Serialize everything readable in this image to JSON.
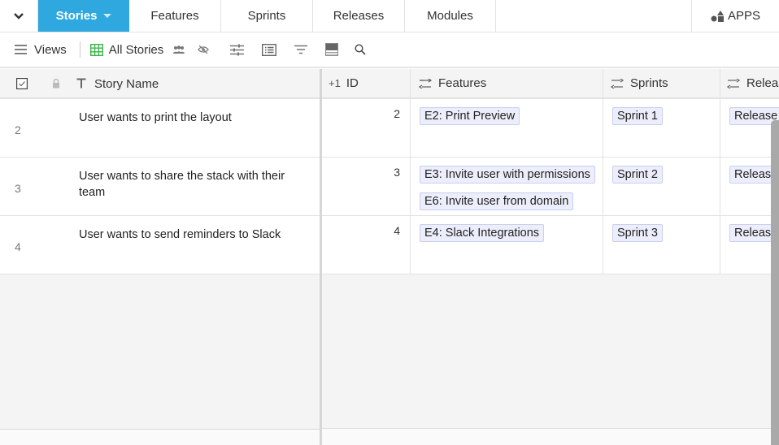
{
  "tabs": {
    "items": [
      {
        "label": "Stories",
        "active": true
      },
      {
        "label": "Features",
        "active": false
      },
      {
        "label": "Sprints",
        "active": false
      },
      {
        "label": "Releases",
        "active": false
      },
      {
        "label": "Modules",
        "active": false
      }
    ],
    "apps_label": "APPS"
  },
  "toolbar": {
    "views_label": "Views",
    "current_view_label": "All Stories",
    "icons": [
      "menu-icon",
      "grid-icon",
      "users-icon",
      "eye-off-icon",
      "sliders-icon",
      "list-icon",
      "filter-icon",
      "row-height-icon",
      "search-icon"
    ]
  },
  "columns": {
    "story_name": "Story Name",
    "id": "ID",
    "id_prefix": "+1",
    "features": "Features",
    "sprints": "Sprints",
    "releases": "Releas"
  },
  "rows": [
    {
      "row_number": "2",
      "story_name": "User wants to print the layout",
      "id": "2",
      "features": [
        "E2: Print Preview"
      ],
      "sprint": "Sprint 1",
      "release": "Release v"
    },
    {
      "row_number": "3",
      "story_name": "User wants to share the stack with their team",
      "id": "3",
      "features": [
        "E3: Invite user with permissions",
        "E6: Invite user from domain"
      ],
      "sprint": "Sprint 2",
      "release": "Release v"
    },
    {
      "row_number": "4",
      "story_name": "User wants to send reminders to Slack",
      "id": "4",
      "features": [
        "E4: Slack Integrations"
      ],
      "sprint": "Sprint 3",
      "release": "Release v"
    }
  ],
  "colors": {
    "accent": "#2ea8df",
    "chip_bg": "#eceefb",
    "chip_border": "#c9cfee"
  }
}
